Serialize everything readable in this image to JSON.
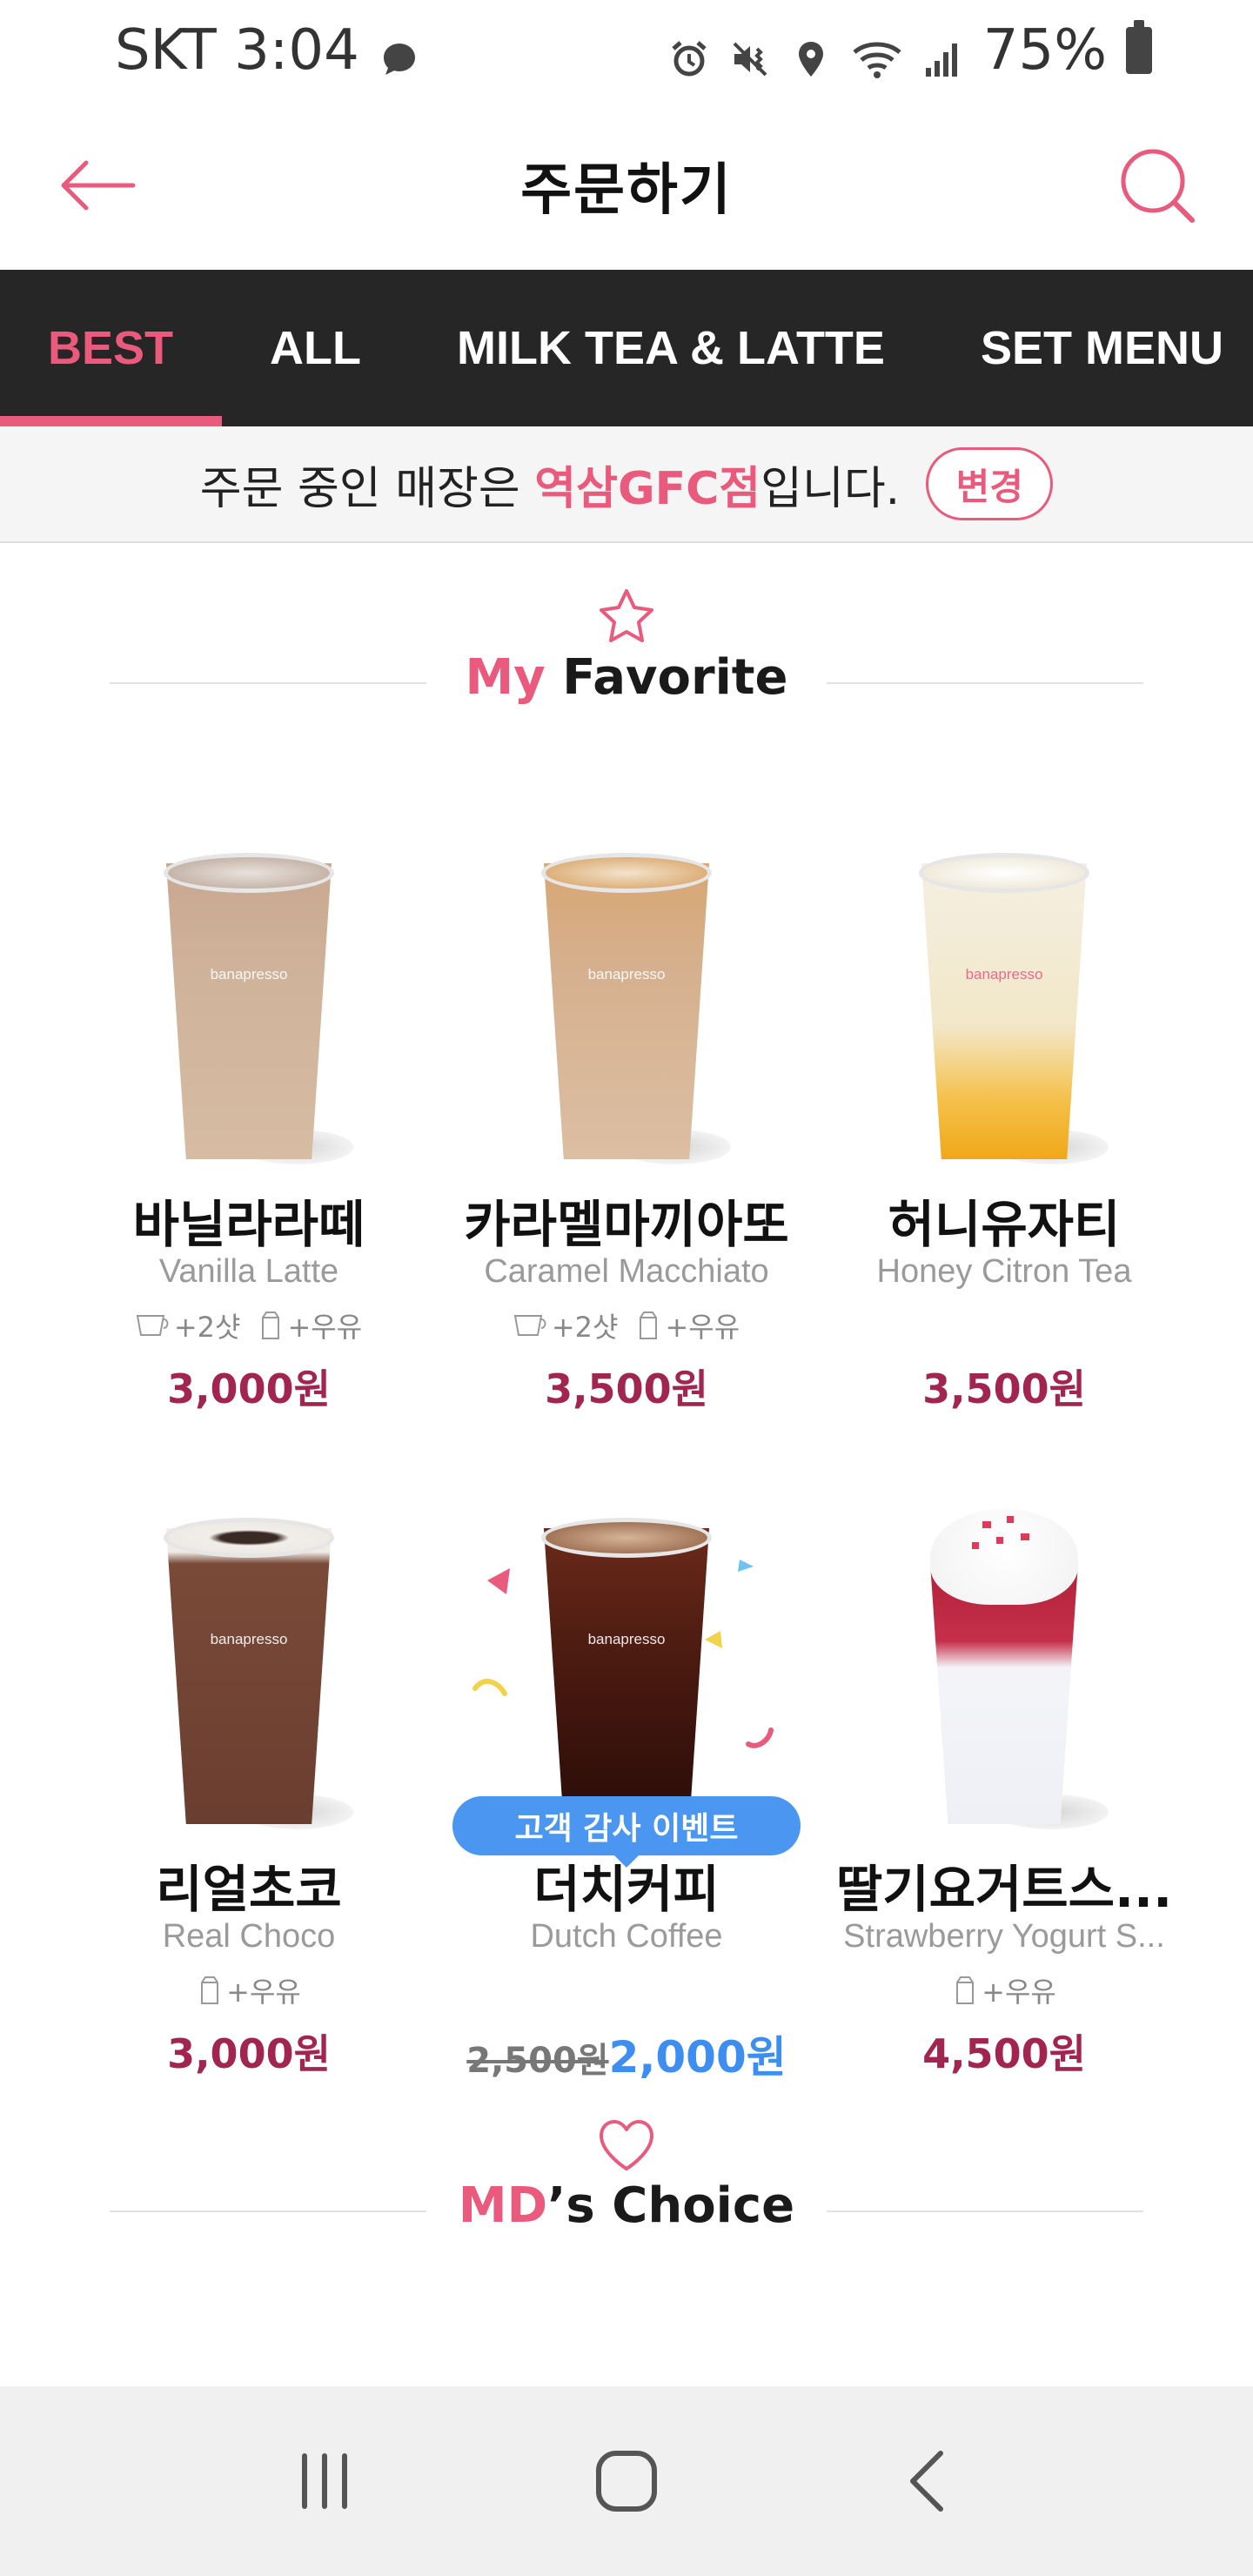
{
  "status_bar": {
    "carrier_time": "SKT 3:04",
    "battery": "75%"
  },
  "header": {
    "title": "주문하기",
    "back_icon": "arrow-left-icon",
    "search_icon": "search-icon"
  },
  "tabs": [
    {
      "label": "BEST",
      "active": true
    },
    {
      "label": "ALL",
      "active": false
    },
    {
      "label": "MILK TEA & LATTE",
      "active": false
    },
    {
      "label": "SET MENU",
      "active": false
    }
  ],
  "store_bar": {
    "prefix": "주문 중인 매장은",
    "store": "역삼GFC점",
    "suffix": "입니다.",
    "change_label": "변경"
  },
  "favorite_section": {
    "accent": "My",
    "title": " Favorite",
    "icon": "star-icon"
  },
  "products": [
    {
      "name_ko": "바닐라라떼",
      "name_en": "Vanilla Latte",
      "opt_shot": "+2샷",
      "opt_milk": "+우유",
      "price": "3,000원"
    },
    {
      "name_ko": "카라멜마끼아또",
      "name_en": "Caramel Macchiato",
      "opt_shot": "+2샷",
      "opt_milk": "+우유",
      "price": "3,500원"
    },
    {
      "name_ko": "허니유자티",
      "name_en": "Honey Citron Tea",
      "price": "3,500원"
    },
    {
      "name_ko": "리얼초코",
      "name_en": "Real Choco",
      "opt_milk": "+우유",
      "price": "3,000원"
    },
    {
      "name_ko": "더치커피",
      "name_en": "Dutch Coffee",
      "badge": "고객 감사 이벤트",
      "price_old": "2,500원",
      "price": "2,000원"
    },
    {
      "name_ko": "딸기요거트스...",
      "name_en": "Strawberry Yogurt S...",
      "opt_milk": "+우유",
      "price": "4,500원"
    }
  ],
  "cup_logo": "banapresso",
  "md_section": {
    "accent": "MD",
    "title": "’s Choice",
    "icon": "heart-icon"
  },
  "colors": {
    "accent_pink": "#ea5a7d",
    "price_red": "#a1254f",
    "sale_blue": "#3d8ef0",
    "tab_bg": "#262626"
  }
}
